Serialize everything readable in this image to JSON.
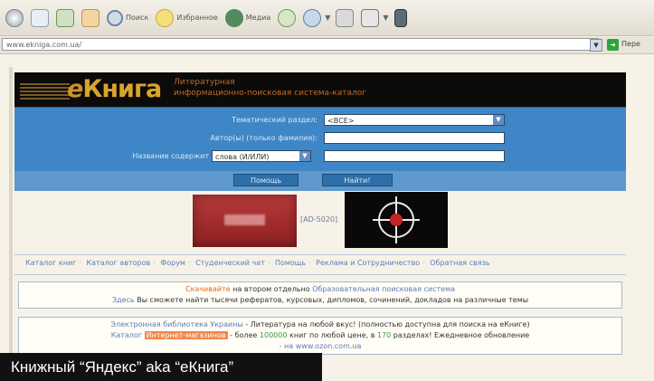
{
  "toolbar": {
    "back_label": "",
    "search_label": "Поиск",
    "favorites_label": "Избранное",
    "media_label": "Медиа"
  },
  "address": {
    "url": "www.ekniga.com.ua/",
    "go_label": "Пере"
  },
  "banner": {
    "logo_e": "e",
    "logo_main": "Книга",
    "tagline_1": "Литературная",
    "tagline_2": "информационно-поисковая система-каталог"
  },
  "form": {
    "section_label": "Тематический раздел:",
    "section_value": "<ВСЕ>",
    "author_label": "Автор(ы) (только фамилия):",
    "title_label": "Название содержит",
    "title_mode_value": "слова (И/ИЛИ)",
    "help_button": "Помощь",
    "find_button": "Найти!"
  },
  "ads": {
    "middle_label": "[AD-5020]"
  },
  "nav": {
    "items": [
      "Каталог книг",
      "Каталог авторов",
      "Форум",
      "Студенческий чат",
      "Помощь",
      "Реклама и Сотрудничество",
      "Обратная связь"
    ]
  },
  "notice": {
    "line1_highlight": "Скачивайте",
    "line1_text": "на втором отдельно",
    "line1_link": "Образовательная поисковая система",
    "line2_link": "Здесь",
    "line2_text": "Вы сможете найти тысячи рефератов, курсовых, дипломов, сочинений, докладов на различные темы"
  },
  "library": {
    "line1_link": "Электронная библиотека Украины",
    "line1_text": "- Литература на любой вкус! (полностью доступна для поиска на eКниге)",
    "line2_link": "Каталог",
    "line2_highlight": "Интернет-магазинов",
    "line2_text_a": "- более",
    "line2_num_a": "100000",
    "line2_text_b": "книг по любой цене, в",
    "line2_num_b": "170",
    "line2_text_c": "разделах! Ежедневное обновление",
    "line3_link": "- на www.ozon.com.ua"
  },
  "caption": {
    "text": "Книжный “Яндекс” aka “eКнига”"
  }
}
